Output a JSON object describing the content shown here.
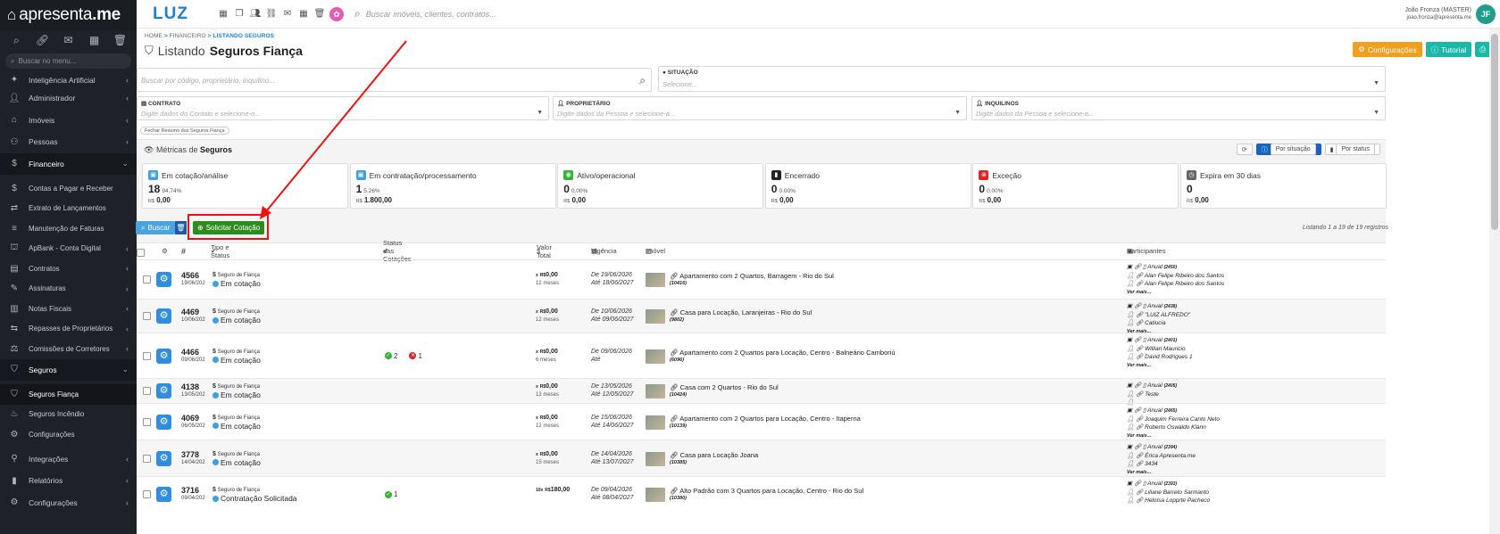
{
  "app": {
    "logo": "apresenta",
    "logo_bold": ".me",
    "brand": "LUZ",
    "brand_small": "IMOBILIÁRIA"
  },
  "sidebar": {
    "search_placeholder": "Buscar no menu...",
    "items": [
      {
        "label": "Inteligência Artificial",
        "icon": "ai-icon",
        "arrow": "‹"
      },
      {
        "label": "Administrador",
        "icon": "user-icon",
        "arrow": "‹"
      },
      {
        "label": "Imóveis",
        "icon": "home-icon",
        "arrow": "‹"
      },
      {
        "label": "Pessoas",
        "icon": "people-icon",
        "arrow": "‹"
      },
      {
        "label": "Financeiro",
        "icon": "money-icon",
        "arrow": "⌄"
      },
      {
        "label": "Contas a Pagar e Receber",
        "icon": "dollar-icon"
      },
      {
        "label": "Extrato de Lançamentos",
        "icon": "transfer-icon"
      },
      {
        "label": "Manutenção de Faturas",
        "icon": "invoice-icon"
      },
      {
        "label": "ApBank - Conta Digital",
        "icon": "bank-icon",
        "arrow": "‹"
      },
      {
        "label": "Contratos",
        "icon": "contract-icon",
        "arrow": "‹"
      },
      {
        "label": "Assinaturas",
        "icon": "signature-icon",
        "arrow": "‹"
      },
      {
        "label": "Notas Fiscais",
        "icon": "receipt-icon",
        "arrow": "‹"
      },
      {
        "label": "Repasses de Proprietários",
        "icon": "repasse-icon",
        "arrow": "‹"
      },
      {
        "label": "Comissões de Corretores",
        "icon": "commission-icon",
        "arrow": "‹"
      },
      {
        "label": "Seguros",
        "icon": "shield-icon",
        "arrow": "⌄"
      },
      {
        "label": "Seguros Fiança",
        "icon": "shield-user-icon"
      },
      {
        "label": "Seguros Incêndio",
        "icon": "fire-icon"
      },
      {
        "label": "Configurações",
        "icon": "gear-icon"
      },
      {
        "label": "Integrações",
        "icon": "plug-icon",
        "arrow": "‹"
      },
      {
        "label": "Relatórios",
        "icon": "chart-icon",
        "arrow": "‹"
      },
      {
        "label": "Configurações",
        "icon": "settings-icon",
        "arrow": "‹"
      }
    ]
  },
  "topbar": {
    "search_placeholder": "Buscar imóveis, clientes, contratos...",
    "user_name": "João Fronza (MASTER)",
    "user_email": "joao.fronza@apresenta.me",
    "avatar": "JF"
  },
  "breadcrumb": {
    "home": "HOME",
    "sep1": ">",
    "fin": "FINANCEIRO",
    "sep2": ">",
    "current": "LISTANDO SEGUROS"
  },
  "title": {
    "prefix": "Listando",
    "bold": "Seguros Fiança"
  },
  "toolbar": {
    "config": "Configurações",
    "tutorial": "Tutorial"
  },
  "filters": {
    "search_placeholder": "Buscar por código, proprietário, inquilino...",
    "situacao_label": "SITUAÇÃO",
    "situacao_ph": "Selecione...",
    "contrato_label": "CONTRATO",
    "contrato_ph": "Digite dados do Contato e selecione-o...",
    "prop_label": "PROPRIETÁRIO",
    "prop_ph": "Digite dados da Pessoa e selecione-a...",
    "inq_label": "INQUILINOS",
    "inq_ph": "Digite dados da Pessoa e selecione-a...",
    "chip": "Fechar Resumo dos Seguros Fiança"
  },
  "metrics": {
    "title_prefix": "Métricas de",
    "title_bold": "Seguros",
    "btn_situacao": "Por situação",
    "btn_status": "Por status",
    "cards": [
      {
        "title": "Em cotação/análise",
        "n": "18",
        "pct": "94.74%",
        "cur": "R$",
        "val": "0,00",
        "color": "#3aa0e8"
      },
      {
        "title": "Em contratação/processamento",
        "n": "1",
        "pct": "5.26%",
        "cur": "R$",
        "val": "1.800,00",
        "color": "#3aa0e8"
      },
      {
        "title": "Ativo/operacional",
        "n": "0",
        "pct": "0.00%",
        "cur": "R$",
        "val": "0,00",
        "color": "#2eb82e"
      },
      {
        "title": "Encerrado",
        "n": "0",
        "pct": "0.00%",
        "cur": "R$",
        "val": "0,00",
        "color": "#222222"
      },
      {
        "title": "Exceção",
        "n": "0",
        "pct": "0.00%",
        "cur": "R$",
        "val": "0,00",
        "color": "#e02424"
      },
      {
        "title": "Expira em 30 dias",
        "n": "0",
        "pct": "",
        "cur": "R$",
        "val": "0,00",
        "color": "#666666"
      }
    ]
  },
  "actions": {
    "buscar": "Buscar",
    "solicitar": "Solicitar Cotação",
    "listing": "Listando 1 a 19 de 19 registros"
  },
  "table": {
    "headers": {
      "hash": "#",
      "tipo": "Tipo e Status",
      "status": "Status das Cotações",
      "valor": "Valor Total",
      "vig": "Vigência",
      "imovel": "Imóvel",
      "part": "Participantes"
    },
    "rows": [
      {
        "id": "4566",
        "date": "19/06/202",
        "type": "Seguro de Fiança",
        "status": "Em cotação",
        "cot": [],
        "mult": "x",
        "cur": "R$",
        "val": "0,00",
        "meses": "12 meses",
        "de": "De 19/06/2026",
        "ate": "Até 18/06/2027",
        "imovel": "Apartamento com 2 Quartos, Barragem - Rio do Sul",
        "code": "(10416)",
        "p1": "Anual",
        "p1c": "(2450)",
        "p2": "Alan Felipe Ribeiro dos Santos",
        "p3": "Alan Felipe Ribeiro dos Santos",
        "vm": "Ver mais..."
      },
      {
        "id": "4469",
        "date": "10/06/202",
        "type": "Seguro de Fiança",
        "status": "Em cotação",
        "cot": [],
        "mult": "x",
        "cur": "R$",
        "val": "0,00",
        "meses": "12 meses",
        "de": "De 10/06/2026",
        "ate": "Até 09/06/2027",
        "imovel": "Casa para Locação, Laranjeiras - Rio do Sul",
        "code": "(9802)",
        "p1": "Anual",
        "p1c": "(2438)",
        "p2": "\"LUIZ ALFREDO\"",
        "p3": "Catiucia",
        "vm": "Ver mais..."
      },
      {
        "id": "4466",
        "date": "09/06/202",
        "type": "Seguro de Fiança",
        "status": "Em cotação",
        "cot": [
          "2",
          "1"
        ],
        "mult": "x",
        "cur": "R$",
        "val": "0,00",
        "meses": "6 meses",
        "de": "De 09/06/2026",
        "ate": "Até",
        "imovel": "Apartamento com 2 Quartos para Locação, Centro - Balneário Camboriú",
        "code": "(6096)",
        "p1": "Anual",
        "p1c": "(2401)",
        "p2": "Willian Mauricio",
        "p3": "David Rodrigues 1",
        "vm": "Ver mais..."
      },
      {
        "id": "4138",
        "date": "13/05/202",
        "type": "Seguro de Fiança",
        "status": "Em cotação",
        "cot": [],
        "mult": "x",
        "cur": "R$",
        "val": "0,00",
        "meses": "12 meses",
        "de": "De 13/05/2026",
        "ate": "Até 12/05/2027",
        "imovel": "Casa com 2 Quartos - Rio do Sul",
        "code": "(10424)",
        "p1": "Anual",
        "p1c": "(2405)",
        "p2": "Teste",
        "p3": "",
        "vm": ""
      },
      {
        "id": "4069",
        "date": "06/05/202",
        "type": "Seguro de Fiança",
        "status": "Em cotação",
        "cot": [],
        "mult": "x",
        "cur": "R$",
        "val": "0,00",
        "meses": "12 meses",
        "de": "De 15/06/2026",
        "ate": "Até 14/06/2027",
        "imovel": "Apartamento com 2 Quartos para Locação, Centro - Itaperna",
        "code": "(10139)",
        "p1": "Anual",
        "p1c": "(2465)",
        "p2": "Joaquim Ferreira Canto Neto",
        "p3": "Roberto Oswaldo Klann",
        "vm": "Ver mais..."
      },
      {
        "id": "3778",
        "date": "14/04/202",
        "type": "Seguro de Fiança",
        "status": "Em cotação",
        "cot": [],
        "mult": "x",
        "cur": "R$",
        "val": "0,00",
        "meses": "15 meses",
        "de": "De 14/04/2026",
        "ate": "Até 13/07/2027",
        "imovel": "Casa para Locação Joana",
        "code": "(10385)",
        "p1": "Anual",
        "p1c": "(2394)",
        "p2": "Érica Apresenta.me",
        "p3": "3434",
        "vm": "Ver mais..."
      },
      {
        "id": "3716",
        "date": "09/04/202",
        "type": "Seguro de Fiança",
        "status": "Contratação Solicitada",
        "cot": [
          "1"
        ],
        "mult": "10x",
        "cur": "R$",
        "val": "180,00",
        "meses": "",
        "de": "De 09/04/2026",
        "ate": "Até 08/04/2027",
        "imovel": "Alto Padrão com 3 Quartos para Locação, Centro - Rio do Sul",
        "code": "(10380)",
        "p1": "Anual",
        "p1c": "(2393)",
        "p2": "Liliane Barreto Sarmanto",
        "p3": "Heloísa Lopprte Pacheco",
        "vm": ""
      }
    ]
  }
}
